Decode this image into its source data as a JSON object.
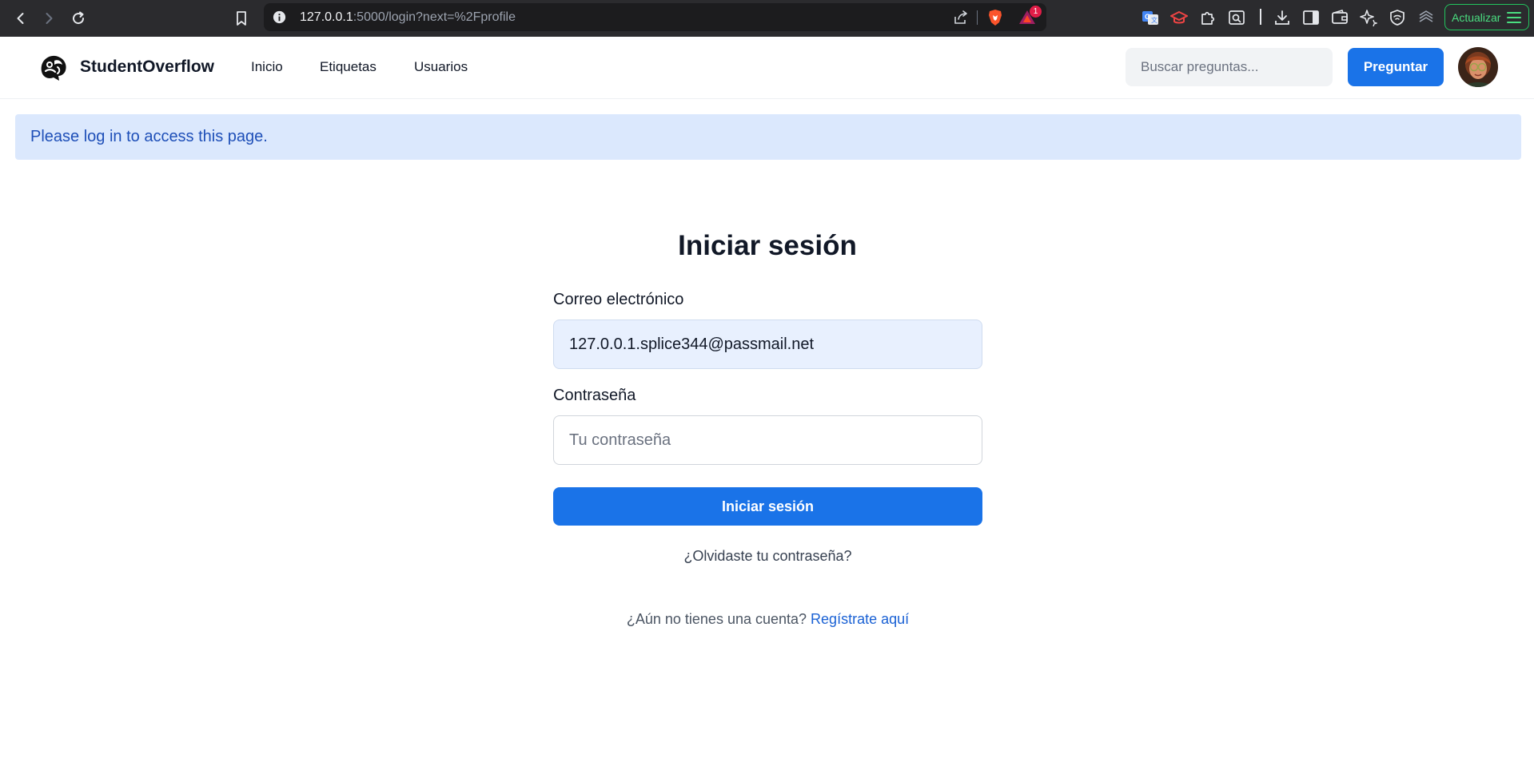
{
  "browser": {
    "url_host": "127.0.0.1",
    "url_rest": ":5000/login?next=%2Fprofile",
    "rewards_badge": "1",
    "update_label": "Actualizar"
  },
  "header": {
    "brand": "StudentOverflow",
    "nav": [
      "Inicio",
      "Etiquetas",
      "Usuarios"
    ],
    "search_placeholder": "Buscar preguntas...",
    "ask_label": "Preguntar"
  },
  "alert": {
    "message": "Please log in to access this page."
  },
  "login": {
    "title": "Iniciar sesión",
    "email_label": "Correo electrónico",
    "email_value": "127.0.0.1.splice344@passmail.net",
    "password_label": "Contraseña",
    "password_placeholder": "Tu contraseña",
    "submit_label": "Iniciar sesión",
    "forgot_label": "¿Olvidaste tu contraseña?",
    "signup_prompt": "¿Aún no tienes una cuenta?",
    "signup_link": "Regístrate aquí"
  },
  "colors": {
    "primary": "#1a73e8",
    "alert_bg": "#dbe8fd",
    "alert_text": "#1e4fb8",
    "chrome_bg": "#2b2b2e"
  },
  "icons": [
    "back-icon",
    "forward-icon",
    "reload-icon",
    "bookmark-icon",
    "info-icon",
    "share-icon",
    "brave-shields-icon",
    "brave-rewards-icon",
    "translate-icon",
    "graduation-cap-icon",
    "puzzle-extension-icon",
    "page-search-icon",
    "download-icon",
    "sidebar-icon",
    "wallet-icon",
    "leo-ai-icon",
    "vpn-shield-icon",
    "stack-layers-icon",
    "hamburger-menu-icon",
    "logo-icon",
    "avatar"
  ]
}
